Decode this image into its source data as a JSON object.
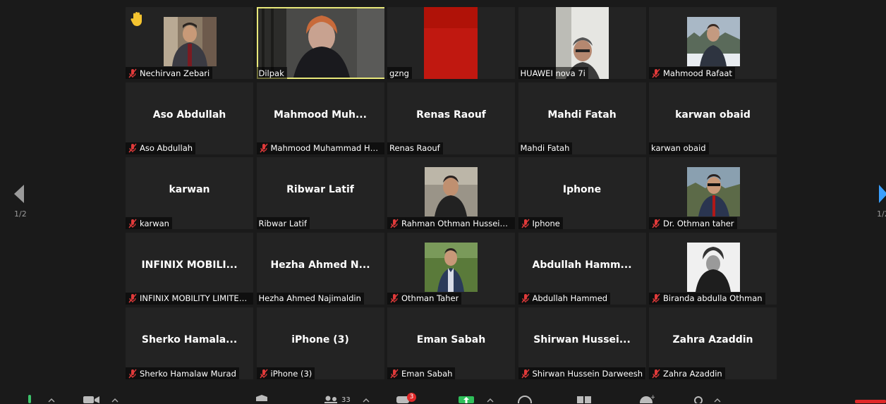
{
  "page_indicator": "1/2",
  "participant_count": "33",
  "chat_badge": "3",
  "participants": [
    {
      "label": "Nechirvan Zebari",
      "muted": true,
      "video": true,
      "hand": true
    },
    {
      "label": "Dilpak",
      "muted": false,
      "video": true,
      "active": true
    },
    {
      "label": "gzng",
      "muted": false,
      "video": true
    },
    {
      "label": "HUAWEI nova 7i",
      "muted": false,
      "video": true
    },
    {
      "label": "Mahmood Rafaat",
      "muted": true,
      "video": true
    },
    {
      "display": "Aso Abdullah",
      "label": "Aso Abdullah",
      "muted": true
    },
    {
      "display": "Mahmood  Muh...",
      "label": "Mahmood Muhammad Ha...",
      "muted": true
    },
    {
      "display": "Renas Raouf",
      "label": "Renas Raouf",
      "muted": false
    },
    {
      "display": "Mahdi Fatah",
      "label": "Mahdi Fatah",
      "muted": false
    },
    {
      "display": "karwan obaid",
      "label": "karwan obaid",
      "muted": false
    },
    {
      "display": "karwan",
      "label": "karwan",
      "muted": true
    },
    {
      "display": "Ribwar Latif",
      "label": "Ribwar Latif",
      "muted": false
    },
    {
      "label": "Rahman Othman Hussein ...",
      "muted": true,
      "video": true
    },
    {
      "display": "Iphone",
      "label": "Iphone",
      "muted": true
    },
    {
      "label": "Dr. Othman taher",
      "muted": true,
      "video": true
    },
    {
      "display": "INFINIX MOBILI...",
      "label": "INFINIX MOBILITY LIMITED ...",
      "muted": true
    },
    {
      "display": "Hezha Ahmed  N...",
      "label": "Hezha Ahmed Najimaldin",
      "muted": false
    },
    {
      "label": "Othman Taher",
      "muted": true,
      "video": true
    },
    {
      "display": "Abdullah  Hamm...",
      "label": "Abdullah Hammed",
      "muted": true
    },
    {
      "label": "Biranda abdulla Othman",
      "muted": true,
      "video": true
    },
    {
      "display": "Sherko  Hamala...",
      "label": "Sherko Hamalaw Murad",
      "muted": true
    },
    {
      "display": "iPhone (3)",
      "label": "iPhone (3)",
      "muted": true
    },
    {
      "display": "Eman Sabah",
      "label": "Eman Sabah",
      "muted": true
    },
    {
      "display": "Shirwan  Hussei...",
      "label": "Shirwan Hussein Darweesh",
      "muted": true
    },
    {
      "display": "Zahra Azaddin",
      "label": "Zahra Azaddin",
      "muted": true
    }
  ]
}
